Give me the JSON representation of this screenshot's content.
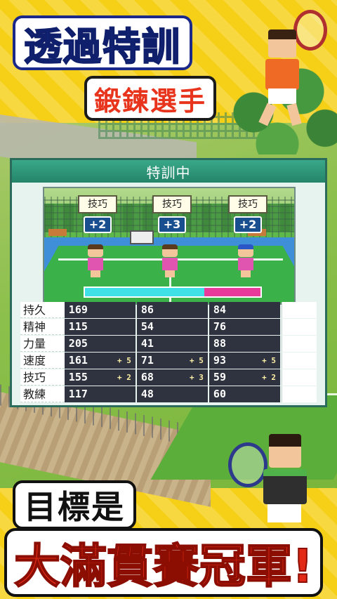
{
  "headline": {
    "line1": "透過特訓",
    "line2": "鍛鍊選手",
    "line3": "目標是",
    "line4": "大滿貫賽冠軍!"
  },
  "panel": {
    "title": "特訓中",
    "skills": [
      {
        "label": "技巧",
        "bonus": "+2"
      },
      {
        "label": "技巧",
        "bonus": "+3"
      },
      {
        "label": "技巧",
        "bonus": "+2"
      }
    ],
    "gauge": {
      "cyan_fraction": 0.68,
      "pink_fraction": 0.32
    },
    "stats": [
      {
        "label": "持久",
        "values": [
          "169",
          "86",
          "84"
        ],
        "bonus": [
          "",
          "",
          ""
        ]
      },
      {
        "label": "精神",
        "values": [
          "115",
          "54",
          "76"
        ],
        "bonus": [
          "",
          "",
          ""
        ]
      },
      {
        "label": "力量",
        "values": [
          "205",
          "41",
          "88"
        ],
        "bonus": [
          "",
          "",
          ""
        ]
      },
      {
        "label": "速度",
        "values": [
          "161",
          "71",
          "93"
        ],
        "bonus": [
          "+ 5",
          "+ 5",
          "+ 5"
        ]
      },
      {
        "label": "技巧",
        "values": [
          "155",
          "68",
          "59"
        ],
        "bonus": [
          "+ 2",
          "+ 3",
          "+ 2"
        ]
      },
      {
        "label": "教練",
        "values": [
          "117",
          "48",
          "60"
        ],
        "bonus": [
          "",
          "",
          ""
        ]
      }
    ]
  },
  "colors": {
    "background": "#f6cf17",
    "panel_header": "#248469",
    "stat_cell": "#2f3340",
    "accent_red": "#e22a16",
    "accent_blue": "#1b3aa8"
  }
}
